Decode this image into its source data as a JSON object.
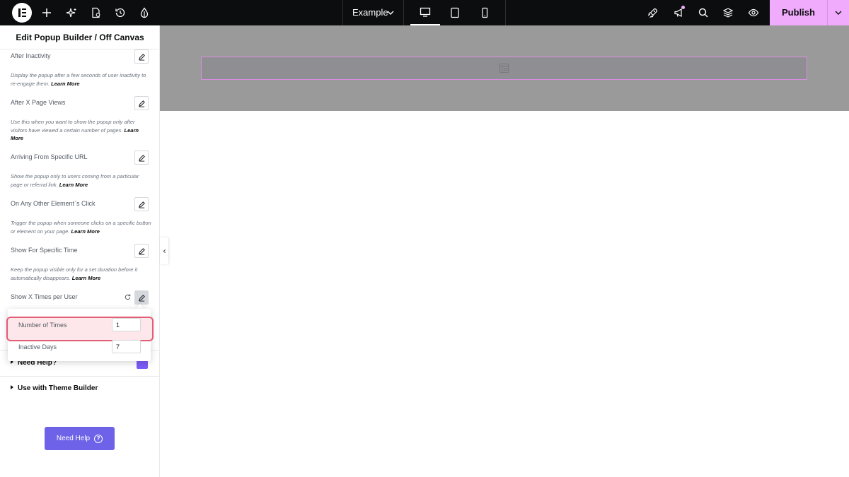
{
  "topbar": {
    "document_name": "Example",
    "publish_label": "Publish",
    "icons": [
      "elementor-logo",
      "plus-icon",
      "ai-sparkle-icon",
      "page-settings-icon",
      "history-icon",
      "site-settings-icon",
      "desktop-icon",
      "tablet-icon",
      "mobile-icon",
      "rocket-icon",
      "announcements-icon",
      "search-icon",
      "layers-icon",
      "preview-eye-icon",
      "chevron-down-icon"
    ],
    "active_device": "desktop"
  },
  "sidebar": {
    "title": "Edit Popup Builder / Off Canvas",
    "controls": [
      {
        "label": "After Inactivity",
        "desc": "Display the popup after a few seconds of user inactivity to re-engage them.",
        "link": "Learn More"
      },
      {
        "label": "After X Page Views",
        "desc": "Use this when you want to show the popup only after visitors have viewed a certain number of pages.",
        "link": "Learn More"
      },
      {
        "label": "Arriving From Specific URL",
        "desc": "Show the popup only to users coming from a particular page or referral link.",
        "link": "Learn More"
      },
      {
        "label": "On Any Other Element`s Click",
        "desc": "Trigger the popup when someone clicks on a specific button or element on your page.",
        "link": "Learn More"
      },
      {
        "label": "Show For Specific Time",
        "desc": "Keep the popup visible only for a set duration before it automatically disappears.",
        "link": "Learn More"
      },
      {
        "label": "Show X Times per User"
      }
    ],
    "popover": {
      "fields": [
        {
          "label": "Number of Times",
          "value": "1"
        },
        {
          "label": "Inactive Days",
          "value": "7"
        }
      ]
    },
    "sections": [
      {
        "title": "Need Help?"
      },
      {
        "title": "Use with Theme Builder"
      }
    ],
    "need_help_button": "Need Help"
  }
}
